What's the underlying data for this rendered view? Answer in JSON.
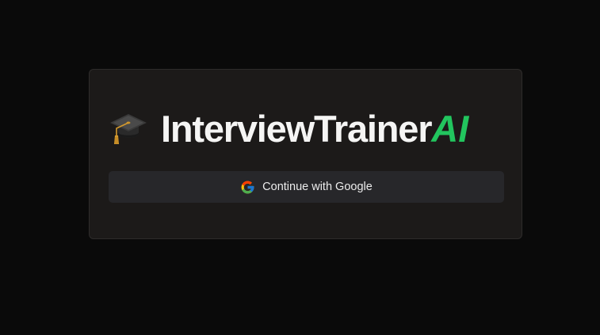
{
  "brand": {
    "icon": "graduation-cap-icon",
    "title_main": "InterviewTrainer",
    "title_accent": "AI",
    "accent_color": "#22c55e"
  },
  "auth": {
    "google_button_label": "Continue with Google",
    "google_icon": "google-g-icon"
  }
}
